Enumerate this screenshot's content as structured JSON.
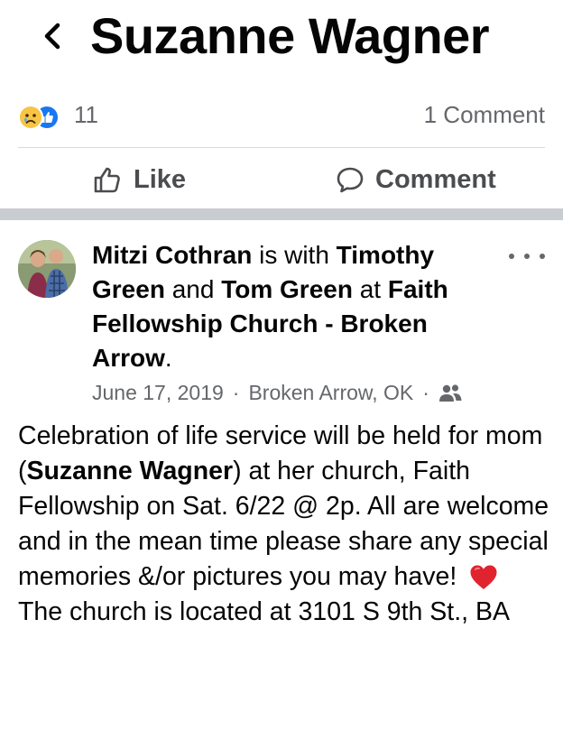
{
  "header": {
    "back_icon": "chevron-left-icon",
    "title": "Suzanne Wagner"
  },
  "stats": {
    "reactions": [
      "sad-reaction-icon",
      "like-reaction-icon"
    ],
    "reaction_count": "11",
    "comment_count": "1 Comment"
  },
  "actions": {
    "like_label": "Like",
    "like_icon": "thumbs-up-icon",
    "comment_label": "Comment",
    "comment_icon": "speech-bubble-icon"
  },
  "post": {
    "author": "Mitzi Cothran",
    "with_text": " is with ",
    "tagged_1": "Timothy Green",
    "and_text": " and ",
    "tagged_2": "Tom Green",
    "at_text": " at ",
    "place": "Faith Fellowship Church - Broken Arrow",
    "end_text": ".",
    "date": "June 17, 2019",
    "separator": "·",
    "location": "Broken Arrow, OK",
    "audience_icon": "friends-icon",
    "more_icon": "more-dots-icon",
    "body_1": "Celebration of life service will be held for mom (",
    "body_bold": "Suzanne Wagner",
    "body_2": ") at her church, Faith Fellowship on Sat. 6/22 @ 2p. All are welcome and in the mean time please share any special memories &/or pictures you may have!",
    "body_emoji": "red-heart-icon",
    "body_3": "The church is located at 3101 S 9th St., BA"
  },
  "colors": {
    "accent": "#1877f2",
    "muted": "#65676b",
    "divider": "#c9ccd1",
    "heart": "#e0242f"
  }
}
